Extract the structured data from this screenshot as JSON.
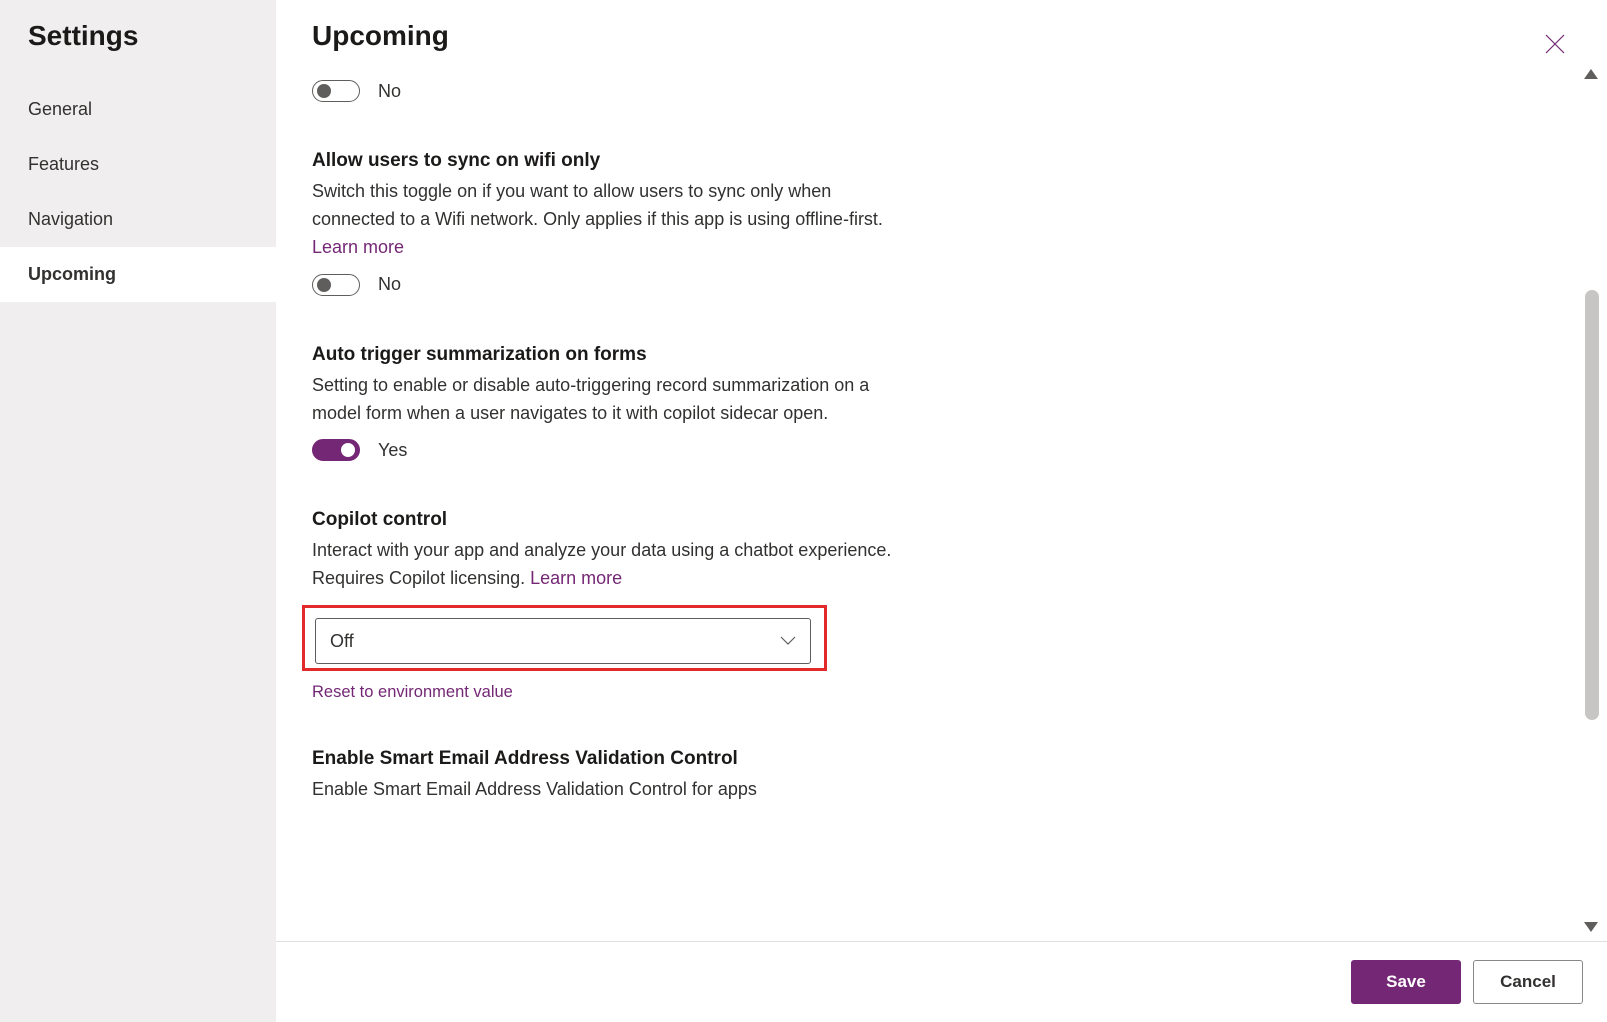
{
  "sidebar": {
    "title": "Settings",
    "items": [
      {
        "label": "General",
        "active": false
      },
      {
        "label": "Features",
        "active": false
      },
      {
        "label": "Navigation",
        "active": false
      },
      {
        "label": "Upcoming",
        "active": true
      }
    ]
  },
  "page": {
    "title": "Upcoming"
  },
  "settings": {
    "fragment_toggle": {
      "state": "off",
      "label": "No"
    },
    "wifi_sync": {
      "title": "Allow users to sync on wifi only",
      "desc": "Switch this toggle on if you want to allow users to sync only when connected to a Wifi network. Only applies if this app is using offline-first. ",
      "learn_more": "Learn more",
      "state": "off",
      "label": "No"
    },
    "auto_summarize": {
      "title": "Auto trigger summarization on forms",
      "desc": "Setting to enable or disable auto-triggering record summarization on a model form when a user navigates to it with copilot sidecar open.",
      "state": "on",
      "label": "Yes"
    },
    "copilot": {
      "title": "Copilot control",
      "desc": "Interact with your app and analyze your data using a chatbot experience. Requires Copilot licensing. ",
      "learn_more": "Learn more",
      "value": "Off",
      "reset": "Reset to environment value"
    },
    "smart_email": {
      "title": "Enable Smart Email Address Validation Control",
      "desc": "Enable Smart Email Address Validation Control for apps"
    }
  },
  "footer": {
    "save": "Save",
    "cancel": "Cancel"
  }
}
